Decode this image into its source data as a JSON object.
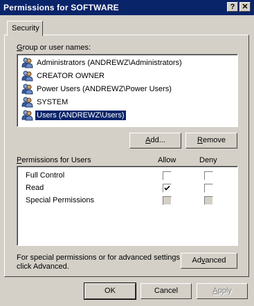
{
  "window": {
    "title": "Permissions for SOFTWARE",
    "help_button": "?",
    "close_button": "✕"
  },
  "tabs": [
    {
      "label": "Security",
      "active": true
    }
  ],
  "group_section": {
    "label": "Group or user names:",
    "users": [
      {
        "name": "Administrators (ANDREWZ\\Administrators)",
        "selected": false
      },
      {
        "name": "CREATOR OWNER",
        "selected": false
      },
      {
        "name": "Power Users (ANDREWZ\\Power Users)",
        "selected": false
      },
      {
        "name": "SYSTEM",
        "selected": false
      },
      {
        "name": "Users (ANDREWZ\\Users)",
        "selected": true
      }
    ],
    "add_button": "Add...",
    "remove_button": "Remove"
  },
  "permissions_section": {
    "label": "Permissions for Users",
    "allow_header": "Allow",
    "deny_header": "Deny",
    "rows": [
      {
        "name": "Full Control",
        "allow": false,
        "deny": false,
        "disabled": false
      },
      {
        "name": "Read",
        "allow": true,
        "deny": false,
        "disabled": false
      },
      {
        "name": "Special Permissions",
        "allow": false,
        "deny": false,
        "disabled": true
      }
    ]
  },
  "advanced_section": {
    "text_line1": "For special permissions or for advanced settings,",
    "text_line2": "click Advanced.",
    "advanced_button": "Advanced"
  },
  "dialog_buttons": {
    "ok": "OK",
    "cancel": "Cancel",
    "apply": "Apply",
    "apply_disabled": true
  },
  "colors": {
    "titlebar": "#0a246a",
    "face": "#d4d0c8",
    "selection": "#0a246a"
  }
}
